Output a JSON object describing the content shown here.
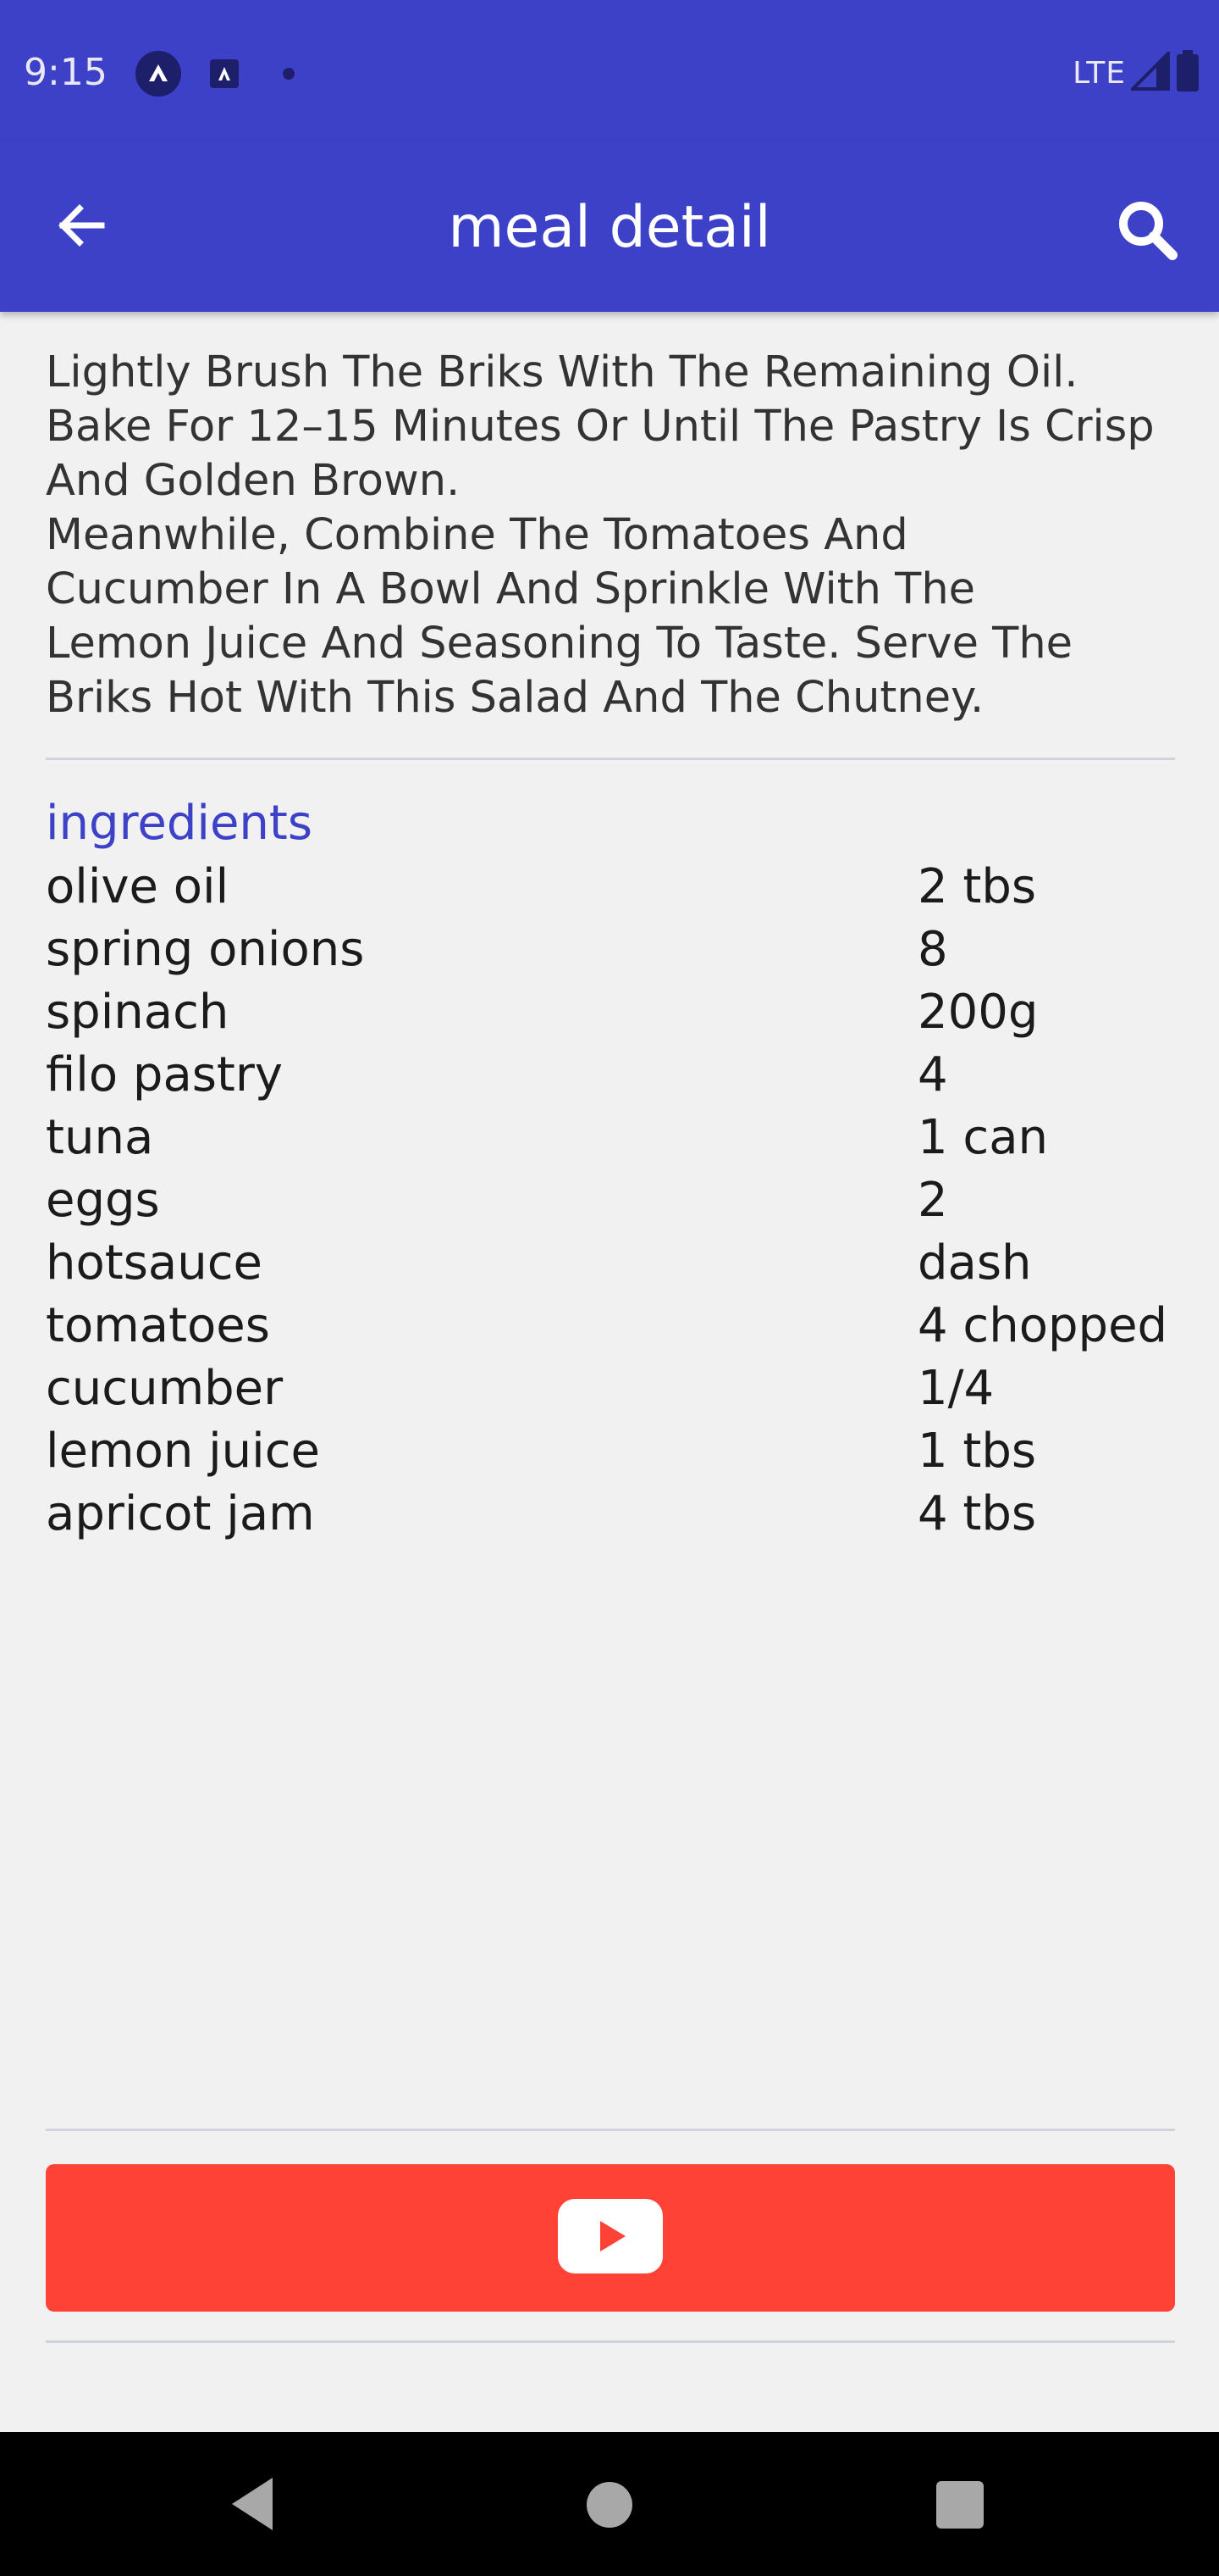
{
  "status_bar": {
    "time": "9:15",
    "network": "LTE"
  },
  "app_bar": {
    "title": "meal detail"
  },
  "instructions_text": "Lightly Brush The Briks With The Remaining Oil.\nBake For 12–15 Minutes Or Until The Pastry Is Crisp\nAnd Golden Brown.\nMeanwhile, Combine The Tomatoes And\nCucumber In A Bowl And Sprinkle With The\nLemon Juice And Seasoning To Taste. Serve The\nBriks Hot With This Salad And The Chutney.",
  "ingredients": {
    "heading": "ingredients",
    "items": [
      {
        "name": "olive oil",
        "measure": "2 tbs"
      },
      {
        "name": "spring onions",
        "measure": "8"
      },
      {
        "name": "spinach",
        "measure": "200g"
      },
      {
        "name": "filo pastry",
        "measure": "4"
      },
      {
        "name": "tuna",
        "measure": "1 can"
      },
      {
        "name": "eggs",
        "measure": "2"
      },
      {
        "name": "hotsauce",
        "measure": "dash"
      },
      {
        "name": "tomatoes",
        "measure": "4 chopped"
      },
      {
        "name": "cucumber",
        "measure": "1/4"
      },
      {
        "name": "lemon juice",
        "measure": "1 tbs"
      },
      {
        "name": "apricot jam",
        "measure": "4 tbs"
      }
    ]
  },
  "icons": {
    "back": "arrow-left-icon",
    "search": "search-icon",
    "youtube": "youtube-icon",
    "nav_back": "triangle-back-icon",
    "nav_home": "circle-home-icon",
    "nav_recent": "square-recent-icon"
  },
  "colors": {
    "primary": "#3d41c8",
    "youtube_red": "#ff4236",
    "background": "#f1f1f1"
  }
}
